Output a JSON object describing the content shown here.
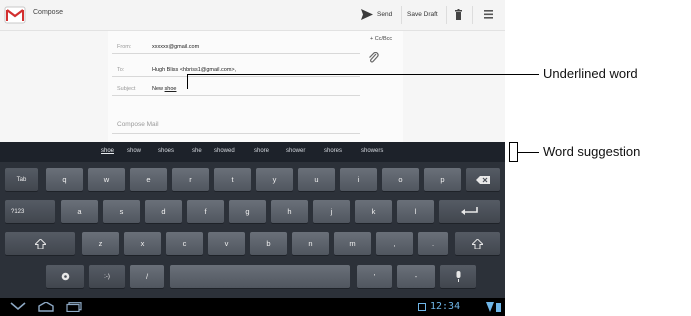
{
  "action_bar": {
    "title": "Compose",
    "send_label": "Send",
    "save_draft_label": "Save Draft",
    "icons": [
      "gmail-app-icon",
      "send-icon",
      "trash-icon",
      "menu-icon"
    ]
  },
  "compose": {
    "from_label": "From:",
    "from_value": "xxxxxx@gmail.com",
    "to_label": "To:",
    "to_value": "Hugh Bliss <hbriss1@gmail.com>,",
    "cc_bcc_label": "+ Cc/Bcc",
    "subject_label": "Subject",
    "subject_prefix": "New",
    "subject_underlined_word": "shoe",
    "body_placeholder": "Compose Mail"
  },
  "suggestions": [
    "shoe",
    "show",
    "shoes",
    "she",
    "showed",
    "shore",
    "shower",
    "shores",
    "showers"
  ],
  "keyboard": {
    "row1": [
      "Tab",
      "q",
      "w",
      "e",
      "r",
      "t",
      "y",
      "u",
      "i",
      "o",
      "p"
    ],
    "row2": [
      "?123",
      "a",
      "s",
      "d",
      "f",
      "g",
      "h",
      "j",
      "k",
      "l"
    ],
    "row3": [
      "z",
      "x",
      "c",
      "v",
      "b",
      "n",
      "m",
      ",",
      "."
    ],
    "row4_keys": [
      ":-)",
      "/",
      "'",
      "-"
    ]
  },
  "system_bar": {
    "clock": "12:34"
  },
  "callouts": {
    "underlined_word": "Underlined word",
    "word_suggestion": "Word suggestion"
  }
}
